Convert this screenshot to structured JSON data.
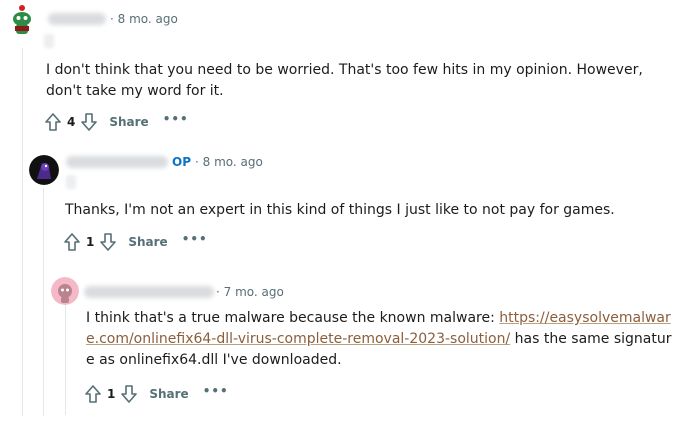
{
  "comments": [
    {
      "time": "8 mo. ago",
      "body": "I don't think that you need to be worried. That's too few hits in my opinion. However, don't take my word for it.",
      "score": "4",
      "share_label": "Share",
      "more_label": "•••"
    },
    {
      "op_badge": "OP",
      "time": "8 mo. ago",
      "body": "Thanks, I'm not an expert in this kind of things I just like to not pay for games.",
      "score": "1",
      "share_label": "Share",
      "more_label": "•••"
    },
    {
      "time": "7 mo. ago",
      "body_before_link": "I think that's a true malware because the known malware: ",
      "link_text": "https://easysolvemalware.com/onlinefix64-dll-virus-complete-removal-2023-solution/",
      "body_after_link": " has the same signature as onlinefix64.dll I've downloaded.",
      "score": "1",
      "share_label": "Share",
      "more_label": "•••"
    }
  ]
}
